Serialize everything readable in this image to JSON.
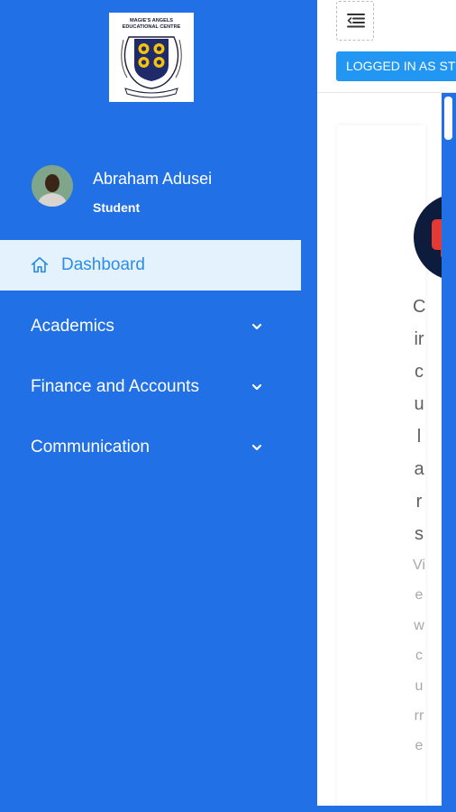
{
  "school": {
    "name_line1": "MAGIE'S ANGELS",
    "name_line2": "EDUCATIONAL CENTRE"
  },
  "profile": {
    "name": "Abraham Adusei",
    "role": "Student"
  },
  "sidebar": {
    "items": [
      {
        "label": "Dashboard",
        "icon": "home-icon",
        "active": true
      },
      {
        "label": "Academics",
        "icon": "chevron-down-icon"
      },
      {
        "label": "Finance and Accounts",
        "icon": "chevron-down-icon"
      },
      {
        "label": "Communication",
        "icon": "chevron-down-icon"
      }
    ]
  },
  "topbar": {
    "toggle_icon": "menu-collapse-icon",
    "badge": "LOGGED IN AS ST"
  },
  "card": {
    "icon": "bell-chat-icon",
    "title": "Circulars",
    "subtitle": "Viewcurre"
  },
  "colors": {
    "sidebar": "#2170e6",
    "active_bg": "#e3f2fd",
    "active_text": "#2d8ceb",
    "badge": "#2196f3",
    "card_icon_bg": "#0d1b3d",
    "card_icon_fg": "#e53935"
  }
}
